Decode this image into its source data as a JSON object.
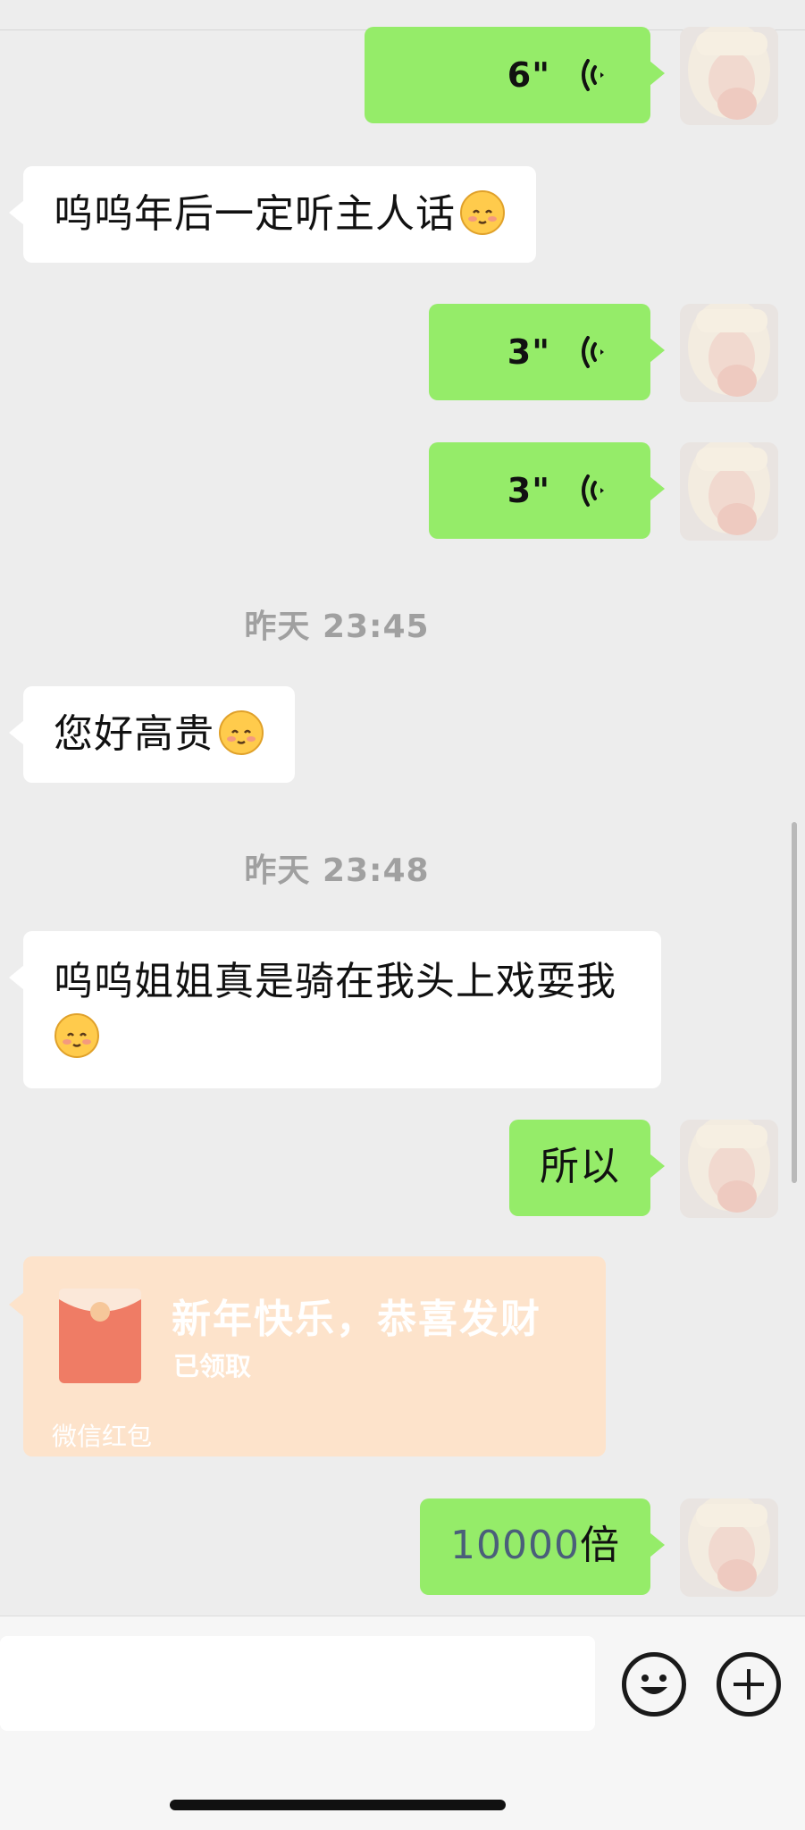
{
  "messages": {
    "voice_1": "6\"",
    "text_1": "呜呜年后一定听主人话",
    "voice_2": "3\"",
    "voice_3": "3\"",
    "time_1": "昨天 23:45",
    "text_2": "您好高贵",
    "time_2": "昨天 23:48",
    "text_3": "呜呜姐姐真是骑在我头上戏耍我",
    "text_4": "所以",
    "redpacket": {
      "title": "新年快乐，恭喜发财",
      "status": "已领取",
      "brand": "微信红包"
    },
    "last": {
      "number": "10000",
      "suffix": "倍"
    }
  },
  "colors": {
    "background": "#ededed",
    "outgoing_bubble": "#95ec69",
    "incoming_bubble": "#ffffff",
    "redpacket_bg": "#fde3cb",
    "timestamp": "#a0a0a0",
    "number_highlight": "#4a5f7a"
  },
  "icons": {
    "voice": "voice-wave-icon",
    "emoji_smile": "pleading-face-emoji",
    "emoji_button": "smiley-face-icon",
    "add_button": "plus-circle-icon",
    "redpacket": "red-envelope-icon"
  }
}
